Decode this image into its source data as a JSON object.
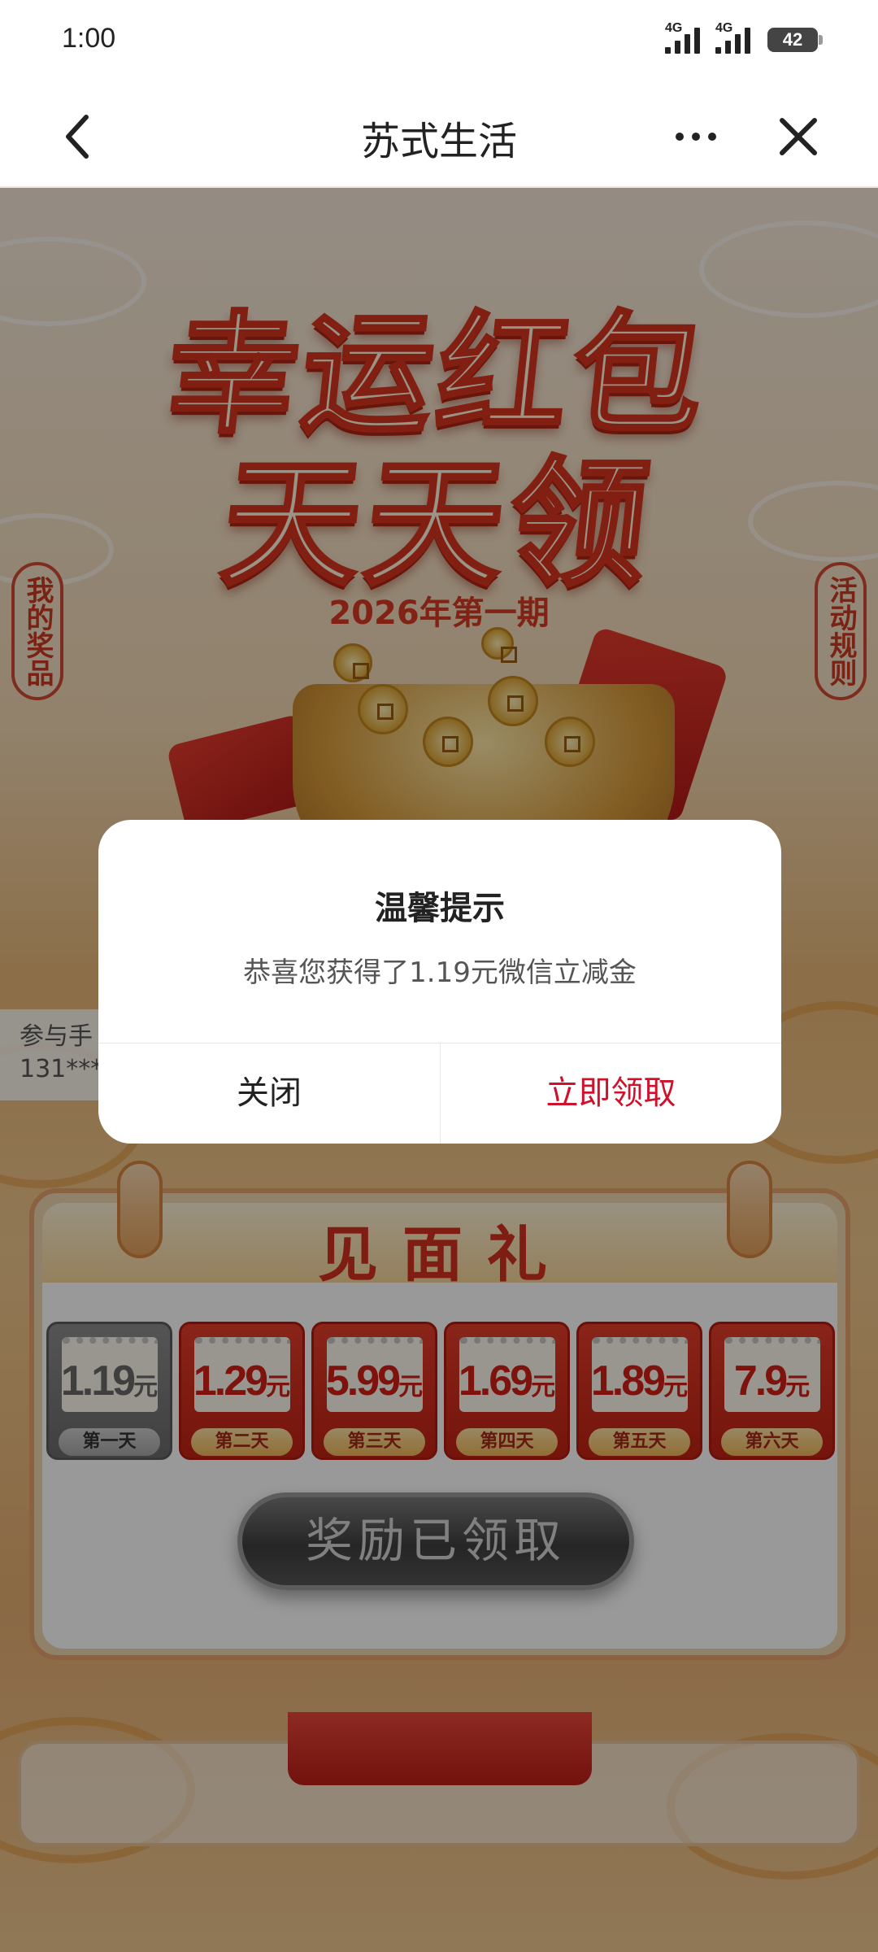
{
  "status_bar": {
    "time": "1:00",
    "network1": "4G",
    "network2": "4G",
    "battery": "42"
  },
  "nav": {
    "title": "苏式生活"
  },
  "campaign": {
    "headline_line1": "幸运红包",
    "headline_line2": "天天领",
    "issue": "2026年第一期",
    "left_tag": "我的奖品",
    "right_tag": "活动规则",
    "participants_label": "参与手",
    "participants_value": "131***"
  },
  "gift": {
    "title": "见面礼",
    "currency": "元",
    "days": [
      {
        "amount": "1.19",
        "label": "第一天",
        "claimed": true
      },
      {
        "amount": "1.29",
        "label": "第二天",
        "claimed": false
      },
      {
        "amount": "5.99",
        "label": "第三天",
        "claimed": false
      },
      {
        "amount": "1.69",
        "label": "第四天",
        "claimed": false
      },
      {
        "amount": "1.89",
        "label": "第五天",
        "claimed": false
      },
      {
        "amount": "7.9",
        "label": "第六天",
        "claimed": false
      }
    ],
    "button": "奖励已领取"
  },
  "dialog": {
    "title": "温馨提示",
    "message": "恭喜您获得了1.19元微信立减金",
    "close": "关闭",
    "claim": "立即领取",
    "accent_color": "#d0112b"
  }
}
